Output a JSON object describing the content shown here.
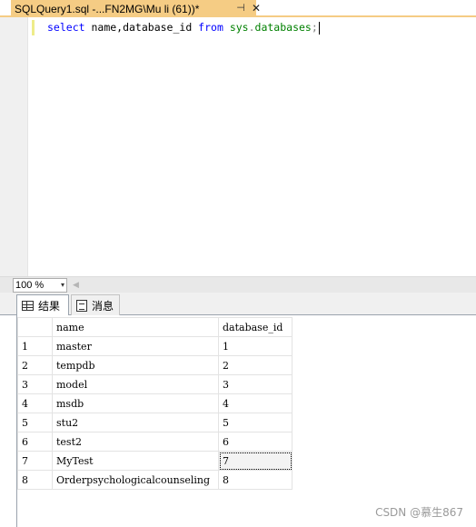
{
  "tab": {
    "title": "SQLQuery1.sql -...FN2MG\\Mu li (61))*",
    "pin_glyph": "⊣",
    "close_glyph": "✕"
  },
  "editor": {
    "tokens": {
      "select": "select",
      "cols": " name,database_id ",
      "from": "from",
      "space": " ",
      "sys": "sys",
      "dot": ".",
      "databases": "databases",
      "semicolon": ";"
    }
  },
  "zoom": {
    "value": "100 %",
    "arrow": "▾",
    "scroll_left": "◀"
  },
  "results_tabs": {
    "results_label": "结果",
    "messages_label": "消息"
  },
  "grid": {
    "columns": [
      "name",
      "database_id"
    ],
    "rows": [
      {
        "num": "1",
        "name": "master",
        "id": "1"
      },
      {
        "num": "2",
        "name": "tempdb",
        "id": "2"
      },
      {
        "num": "3",
        "name": "model",
        "id": "3"
      },
      {
        "num": "4",
        "name": "msdb",
        "id": "4"
      },
      {
        "num": "5",
        "name": "stu2",
        "id": "5"
      },
      {
        "num": "6",
        "name": "test2",
        "id": "6"
      },
      {
        "num": "7",
        "name": "MyTest",
        "id": "7"
      },
      {
        "num": "8",
        "name": "Orderpsychologicalcounseling",
        "id": "8"
      }
    ],
    "selected_row": 6
  },
  "watermark": "CSDN @慕生867",
  "colors": {
    "tab_active": "#f5cc84",
    "keyword": "#0000ff",
    "system_object": "#008000"
  }
}
